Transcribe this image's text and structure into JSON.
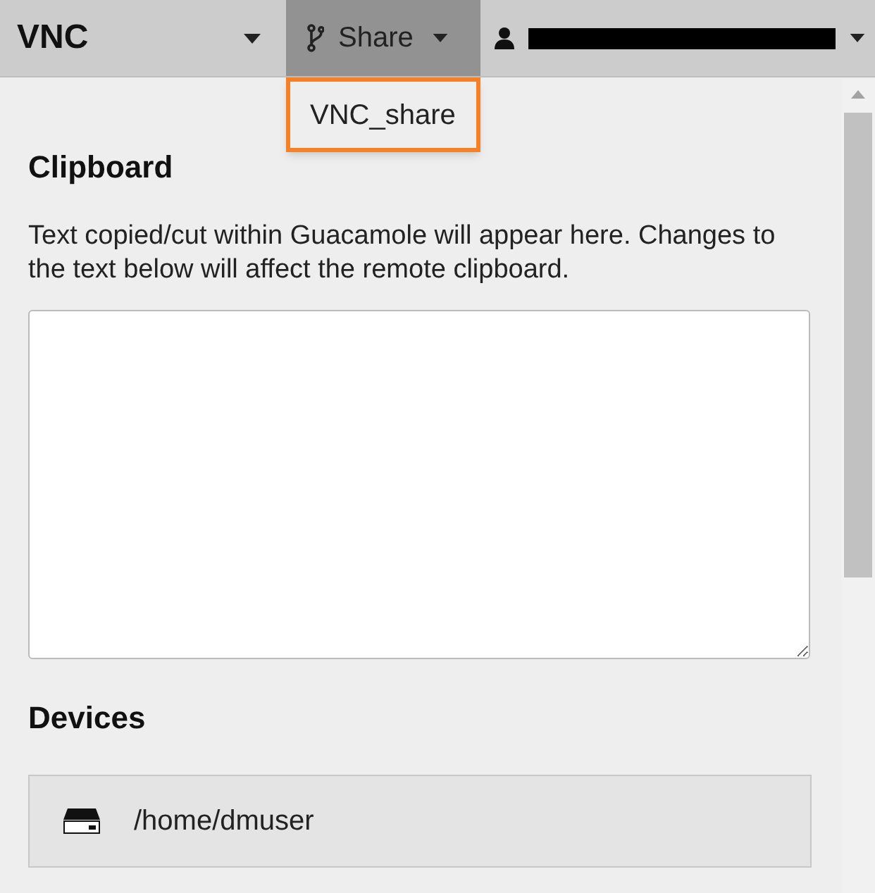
{
  "menu_bar": {
    "connection": {
      "label": "VNC",
      "expanded": false
    },
    "share": {
      "label": "Share",
      "expanded": true,
      "items": [
        {
          "label": "VNC_share",
          "highlighted": true
        }
      ]
    },
    "user": {
      "redacted": true
    }
  },
  "clipboard": {
    "heading": "Clipboard",
    "description": "Text copied/cut within Guacamole will appear here. Changes to the text below will affect the remote clipboard."
  },
  "devices": {
    "heading": "Devices",
    "items": [
      {
        "label": "/home/dmuser"
      }
    ]
  }
}
